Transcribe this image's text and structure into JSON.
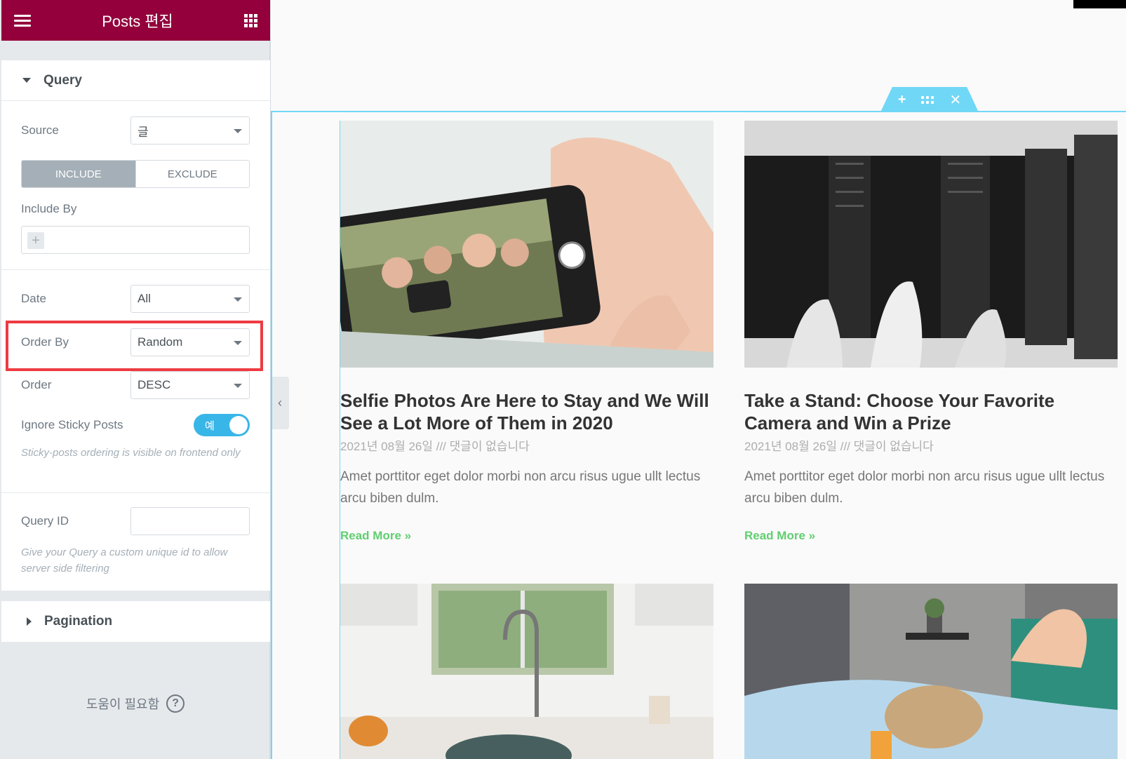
{
  "panel": {
    "title": "Posts 편집",
    "query": {
      "heading": "Query",
      "source_label": "Source",
      "source_value": "글",
      "tab_include": "INCLUDE",
      "tab_exclude": "EXCLUDE",
      "include_by_label": "Include By",
      "include_add": "+",
      "date_label": "Date",
      "date_value": "All",
      "order_by_label": "Order By",
      "order_by_value": "Random",
      "order_label": "Order",
      "order_value": "DESC",
      "ignore_sticky_label": "Ignore Sticky Posts",
      "ignore_sticky_toggle": "예",
      "sticky_note": "Sticky-posts ordering is visible on frontend only",
      "query_id_label": "Query ID",
      "query_id_value": "",
      "query_id_note": "Give your Query a custom unique id to allow server side filtering"
    },
    "pagination": {
      "heading": "Pagination"
    },
    "help": "도움이 필요함",
    "help_icon": "?"
  },
  "canvas": {
    "handle": {
      "add": "+",
      "close": "✕"
    },
    "collapse_arrow": "‹",
    "posts": [
      {
        "title": "Selfie Photos Are Here to Stay and We Will See a Lot More of Them in 2020",
        "meta": "2021년 08월 26일 /// 댓글이 없습니다",
        "excerpt": "Amet porttitor eget dolor morbi non arcu risus ugue ullt lectus arcu biben dulm.",
        "read_more": "Read More »",
        "image": "selfie-phone-photo"
      },
      {
        "title": "Take a Stand: Choose Your Favorite Camera and Win a Prize",
        "meta": "2021년 08월 26일 /// 댓글이 없습니다",
        "excerpt": "Amet porttitor eget dolor morbi non arcu risus ugue ullt lectus arcu biben dulm.",
        "read_more": "Read More »",
        "image": "camera-lens-photo"
      },
      {
        "image": "kitchen-photo"
      },
      {
        "image": "bedroom-photo"
      }
    ]
  },
  "colors": {
    "header_bg": "#93003c",
    "accent_blue": "#71d7f7",
    "toggle_on": "#39b6e8",
    "read_more": "#61ce70",
    "highlight": "#ee3b42"
  }
}
